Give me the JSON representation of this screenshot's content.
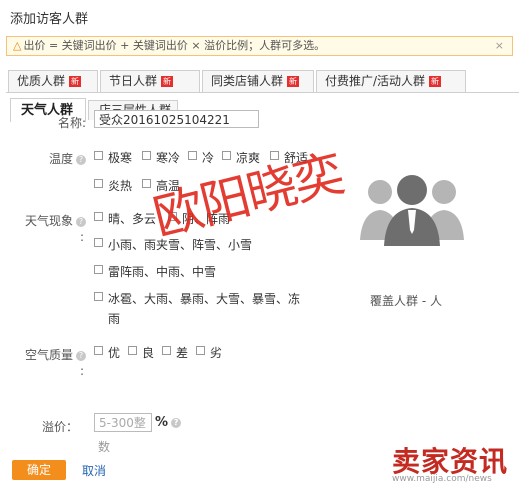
{
  "dialog": {
    "title": "添加访客人群"
  },
  "notice": {
    "icon": "warning-icon",
    "text": "出价 = 关键词出价 + 关键词出价 × 溢价比例；人群可多选。",
    "close": "×"
  },
  "tabs": [
    {
      "label": "优质人群",
      "badge": "新"
    },
    {
      "label": "节日人群",
      "badge": "新"
    },
    {
      "label": "同类店铺人群",
      "badge": "新"
    },
    {
      "label": "付费推广/活动人群",
      "badge": "新"
    }
  ],
  "subtabs": [
    {
      "label": "天气人群",
      "active": true
    },
    {
      "label": "店三层性人群",
      "active": false
    }
  ],
  "form": {
    "name_label": "名称:",
    "name_value": "受众20161025104221",
    "temp_label": "温度",
    "temp_options": [
      "极寒",
      "寒冷",
      "冷",
      "凉爽",
      "舒适",
      "炎热",
      "高温"
    ],
    "weather_label": "天气现象",
    "weather_options": [
      "晴、多云",
      "阴、阵雨",
      "小雨、雨夹雪、阵雪、小雪",
      "雷阵雨、中雨、中雪",
      "冰雹、大雨、暴雨、大雪、暴雪、冻",
      "雨"
    ],
    "air_label": "空气质量",
    "air_options": [
      "优",
      "良",
      "差",
      "劣"
    ],
    "colon": ":",
    "help": "?",
    "bid_label": "溢价：",
    "bid_placeholder": "5-300整",
    "bid_unit": "%",
    "bid_unit2": "数"
  },
  "coverage": {
    "text": "覆盖人群 - 人",
    "icon": "people-group-icon"
  },
  "watermark": "欧阳晓奕",
  "buttons": {
    "ok": "确定",
    "cancel": "取消"
  },
  "logo": {
    "text": "卖家资讯",
    "url": "www.maijia.com/news"
  },
  "colors": {
    "accent": "#f38e1c",
    "link": "#2566b3",
    "badge": "#e3302f",
    "watermark": "#e0281c"
  }
}
